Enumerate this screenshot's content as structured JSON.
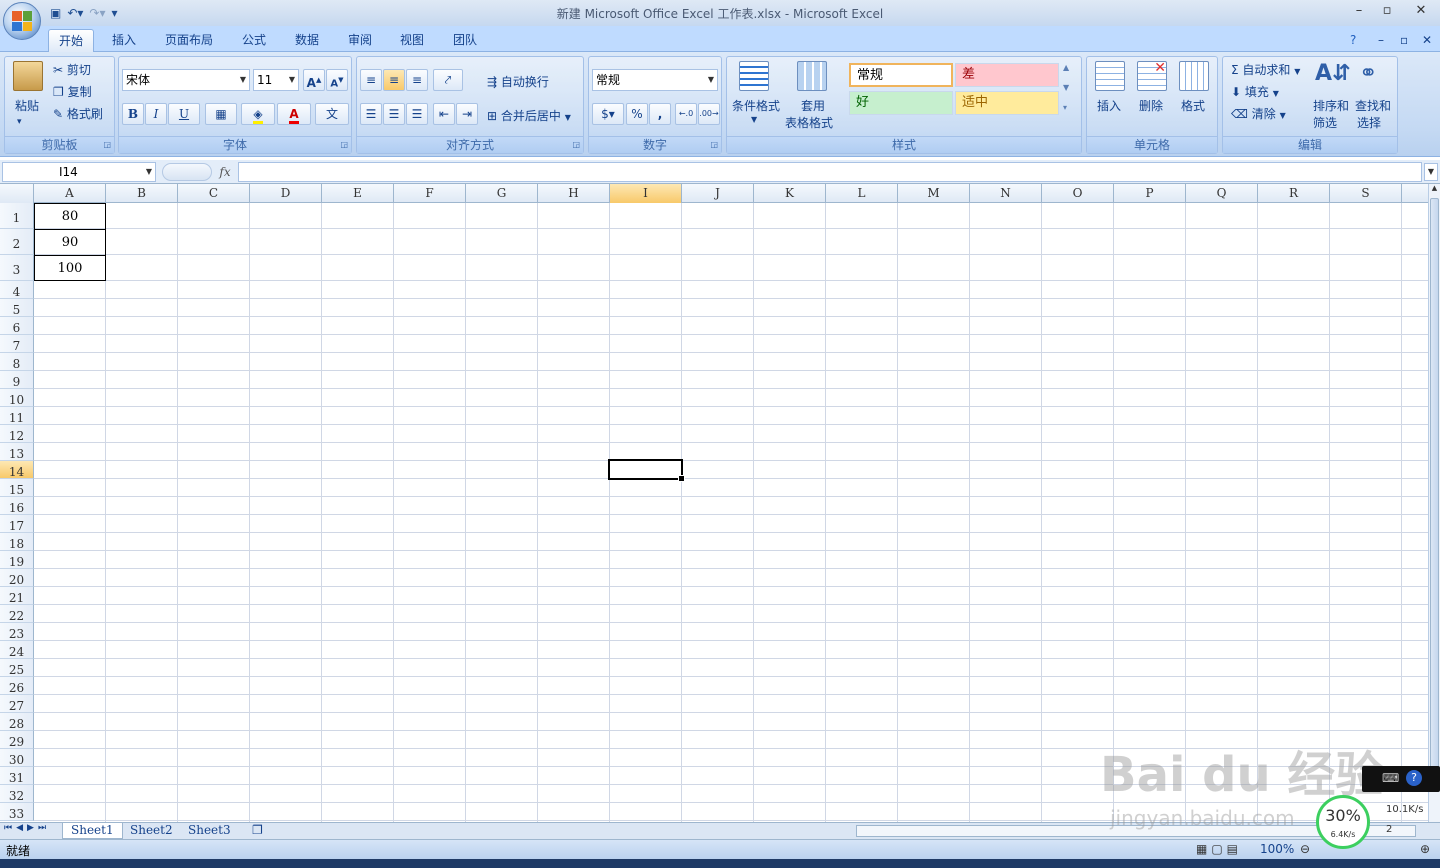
{
  "window": {
    "title": "新建 Microsoft Office Excel 工作表.xlsx - Microsoft Excel",
    "minimize": "–",
    "restore": "▫",
    "close": "✕"
  },
  "tabs": [
    "开始",
    "插入",
    "页面布局",
    "公式",
    "数据",
    "审阅",
    "视图",
    "团队"
  ],
  "ribbon": {
    "clipboard": {
      "paste": "粘贴",
      "cut": "剪切",
      "copy": "复制",
      "format_painter": "格式刷",
      "label": "剪贴板"
    },
    "font": {
      "name": "宋体",
      "size": "11",
      "bold": "B",
      "italic": "I",
      "underline": "U",
      "label": "字体"
    },
    "alignment": {
      "wrap": "自动换行",
      "merge": "合并后居中",
      "label": "对齐方式"
    },
    "number": {
      "format": "常规",
      "percent": "%",
      "comma": ",",
      "label": "数字"
    },
    "styles": {
      "conditional": "条件格式",
      "table_line1": "套用",
      "table_line2": "表格格式",
      "normal": "常规",
      "bad": "差",
      "good": "好",
      "neutral": "适中",
      "label": "样式"
    },
    "cells": {
      "insert": "插入",
      "delete": "删除",
      "format": "格式",
      "label": "单元格"
    },
    "editing": {
      "autosum": "自动求和",
      "fill": "填充",
      "clear": "清除",
      "sort_line1": "排序和",
      "sort_line2": "筛选",
      "find_line1": "查找和",
      "find_line2": "选择",
      "label": "编辑"
    }
  },
  "formula_bar": {
    "name_box": "I14",
    "fx": "fx",
    "value": ""
  },
  "columns": [
    "A",
    "B",
    "C",
    "D",
    "E",
    "F",
    "G",
    "H",
    "I",
    "J",
    "K",
    "L",
    "M",
    "N",
    "O",
    "P",
    "Q",
    "R",
    "S"
  ],
  "rows": [
    "1",
    "2",
    "3",
    "4",
    "5",
    "6",
    "7",
    "8",
    "9",
    "10",
    "11",
    "12",
    "13",
    "14",
    "15",
    "16",
    "17",
    "18",
    "19",
    "20",
    "21",
    "22",
    "23",
    "24",
    "25",
    "26",
    "27",
    "28",
    "29",
    "30",
    "31",
    "32",
    "33"
  ],
  "cells": {
    "A1": "80",
    "A2": "90",
    "A3": "100"
  },
  "selected": {
    "col": "I",
    "row": "14"
  },
  "sheets": [
    "Sheet1",
    "Sheet2",
    "Sheet3"
  ],
  "active_sheet": "Sheet1",
  "status": {
    "ready": "就绪",
    "zoom": "100%"
  },
  "overlay": {
    "cpu": "30%",
    "upload": "6.4K/s",
    "download": "10.1K/s",
    "count": "2"
  },
  "watermark": {
    "brand": "Bai du 经验",
    "url": "jingyan.baidu.com"
  }
}
